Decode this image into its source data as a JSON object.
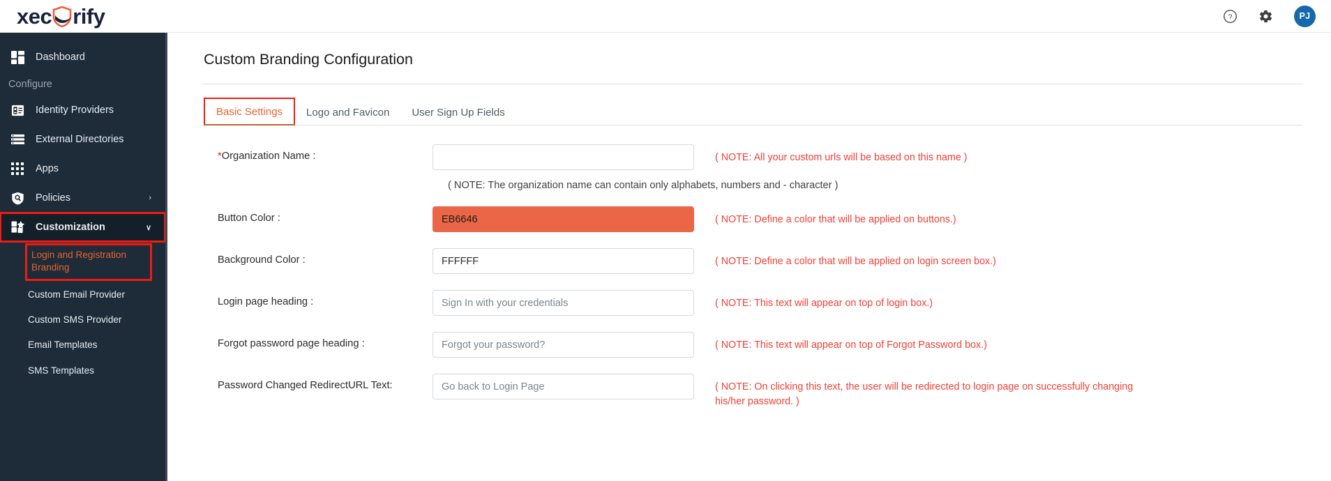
{
  "brand": {
    "name_part1": "xec",
    "name_part2": "rify",
    "logo_icon": "shield-check-icon",
    "shield_color": "#ee5f33",
    "wordmark_color": "#17233c"
  },
  "topbar": {
    "help_icon": "help-circle-icon",
    "settings_icon": "gear-icon",
    "avatar_initials": "PJ",
    "avatar_color": "#1668ab"
  },
  "sidebar": {
    "items": [
      {
        "label": "Dashboard",
        "icon": "dashboard-grid-icon",
        "type": "item"
      },
      {
        "label": "Configure",
        "type": "section"
      },
      {
        "label": "Identity Providers",
        "icon": "id-badge-icon",
        "type": "item"
      },
      {
        "label": "External Directories",
        "icon": "list-rows-icon",
        "type": "item"
      },
      {
        "label": "Apps",
        "icon": "apps-grid-icon",
        "type": "item"
      },
      {
        "label": "Policies",
        "icon": "shield-search-icon",
        "type": "item",
        "chevron": "›"
      },
      {
        "label": "Customization",
        "icon": "puzzle-blocks-icon",
        "type": "item",
        "chevron": "∨",
        "highlighted": true
      }
    ],
    "subitems": [
      {
        "label": "Login and Registration Branding",
        "active": true
      },
      {
        "label": "Custom Email Provider",
        "active": false
      },
      {
        "label": "Custom SMS Provider",
        "active": false
      },
      {
        "label": "Email Templates",
        "active": false
      },
      {
        "label": "SMS Templates",
        "active": false
      }
    ],
    "highlight_color": "#ee1c13",
    "active_text_color": "#e8642f",
    "background": "#1e2b38"
  },
  "main": {
    "page_title": "Custom Branding Configuration",
    "tabs": [
      {
        "label": "Basic Settings",
        "active": true
      },
      {
        "label": "Logo and Favicon",
        "active": false
      },
      {
        "label": "User Sign Up Fields",
        "active": false
      }
    ],
    "fields": [
      {
        "label": "Organization Name :",
        "required": true,
        "value": "",
        "placeholder": "",
        "note": "( NOTE: All your custom urls will be based on this name )",
        "subnote": "( NOTE: The organization name can contain only alphabets, numbers and - character )"
      },
      {
        "label": "Button Color :",
        "required": false,
        "value": "EB6646",
        "placeholder": "",
        "swatch": "#eb6646",
        "note": "( NOTE: Define a color that will be applied on buttons.)"
      },
      {
        "label": "Background Color :",
        "required": false,
        "value": "FFFFFF",
        "placeholder": "",
        "note": "( NOTE: Define a color that will be applied on login screen box.)"
      },
      {
        "label": "Login page heading :",
        "required": false,
        "value": "",
        "placeholder": "Sign In with your credentials",
        "note": "( NOTE: This text will appear on top of login box.)"
      },
      {
        "label": "Forgot password page heading :",
        "required": false,
        "value": "",
        "placeholder": "Forgot your password?",
        "note": "( NOTE: This text will appear on top of Forgot Password box.)"
      },
      {
        "label": "Password Changed RedirectURL Text:",
        "required": false,
        "value": "",
        "placeholder": "Go back to Login Page",
        "note": "( NOTE: On clicking this text, the user will be redirected to login page on successfully changing his/her password. )"
      }
    ],
    "note_color": "#ef4136"
  }
}
